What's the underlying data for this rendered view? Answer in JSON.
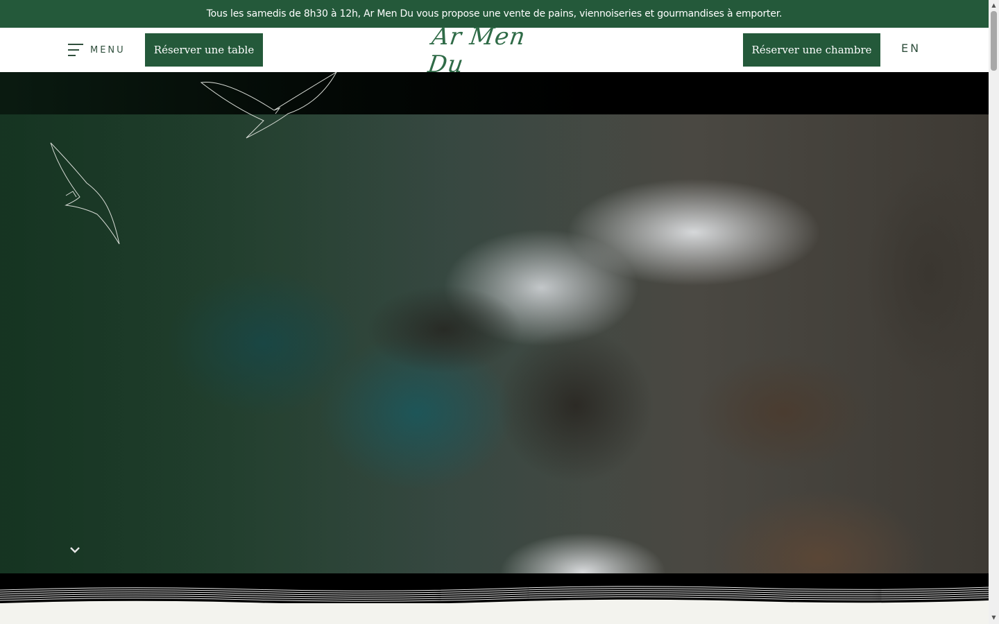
{
  "announcement": {
    "text": "Tous les samedis de 8h30 à 12h, Ar Men Du vous propose une vente de pains, viennoiseries et gourmandises à emporter."
  },
  "header": {
    "menu_label": "MENU",
    "book_table_label": "Réserver une table",
    "logo_text": "Ar Men Du",
    "book_room_label": "Réserver une chambre",
    "language_label": "EN"
  },
  "hero": {
    "media": "aerial-video-rocky-coast",
    "scroll_icon": "chevron-down-icon"
  },
  "colors": {
    "brand_green": "#24593a",
    "logo_green": "#2f6b47",
    "page_background": "#f3f3ee"
  }
}
